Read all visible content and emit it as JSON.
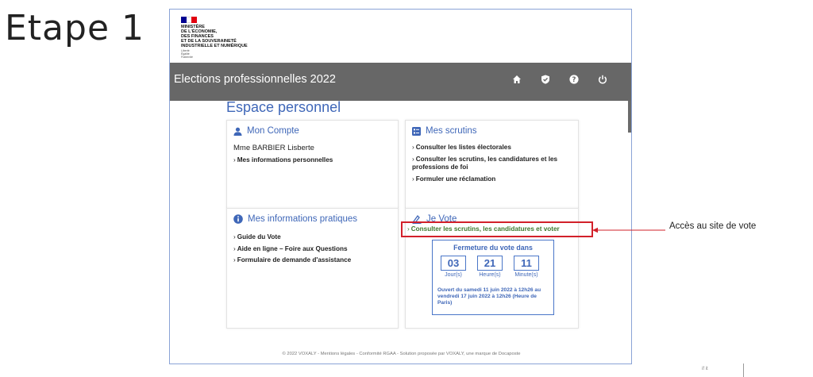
{
  "slide": {
    "step_title": "Etape 1",
    "callout": "Accès au site de vote",
    "corner_mark": "if  it"
  },
  "logo": {
    "ministry_text": "MINISTÈRE\nDE L'ÉCONOMIE,\nDES FINANCES\nET DE LA SOUVERAINETÉ\nINDUSTRIELLE ET NUMÉRIQUE",
    "motto": "Liberté\nÉgalité\nFraternité",
    "flag_colors": [
      "#000091",
      "#ffffff",
      "#e1000f"
    ]
  },
  "header": {
    "title": "Elections professionnelles 2022",
    "icons": [
      "home-icon",
      "shield-check-icon",
      "help-icon",
      "power-icon"
    ]
  },
  "page": {
    "title": "Espace personnel"
  },
  "account": {
    "title": "Mon Compte",
    "user": "Mme BARBIER Lisberte",
    "links": [
      "Mes informations personnelles"
    ]
  },
  "scrutins": {
    "title": "Mes scrutins",
    "links": [
      "Consulter les listes électorales",
      "Consulter les scrutins, les candidatures et les professions de foi",
      "Formuler une réclamation"
    ]
  },
  "info": {
    "title": "Mes informations pratiques",
    "links": [
      "Guide du Vote",
      "Aide en ligne – Foire aux Questions",
      "Formulaire de demande d'assistance"
    ]
  },
  "vote": {
    "title": "Je Vote",
    "link": "Consulter les scrutins, les candidatures et voter",
    "countdown_title": "Fermeture du vote dans",
    "days": "03",
    "hours": "21",
    "minutes": "11",
    "days_label": "Jour(s)",
    "hours_label": "Heure(s)",
    "minutes_label": "Minute(s)",
    "period": "Ouvert du samedi 11 juin 2022 à 12h26 au vendredi 17 juin 2022 à 12h26 (Heure de Paris)"
  },
  "footer": {
    "text": "© 2022 VOXALY - Mentions légales - Conformité RGAA - Solution proposée par VOXALY, une marque de Docaposte"
  },
  "colors": {
    "accent": "#3f67b8",
    "header_bg": "#676767",
    "highlight": "#d2202a",
    "vote_link": "#3f7a2e"
  }
}
